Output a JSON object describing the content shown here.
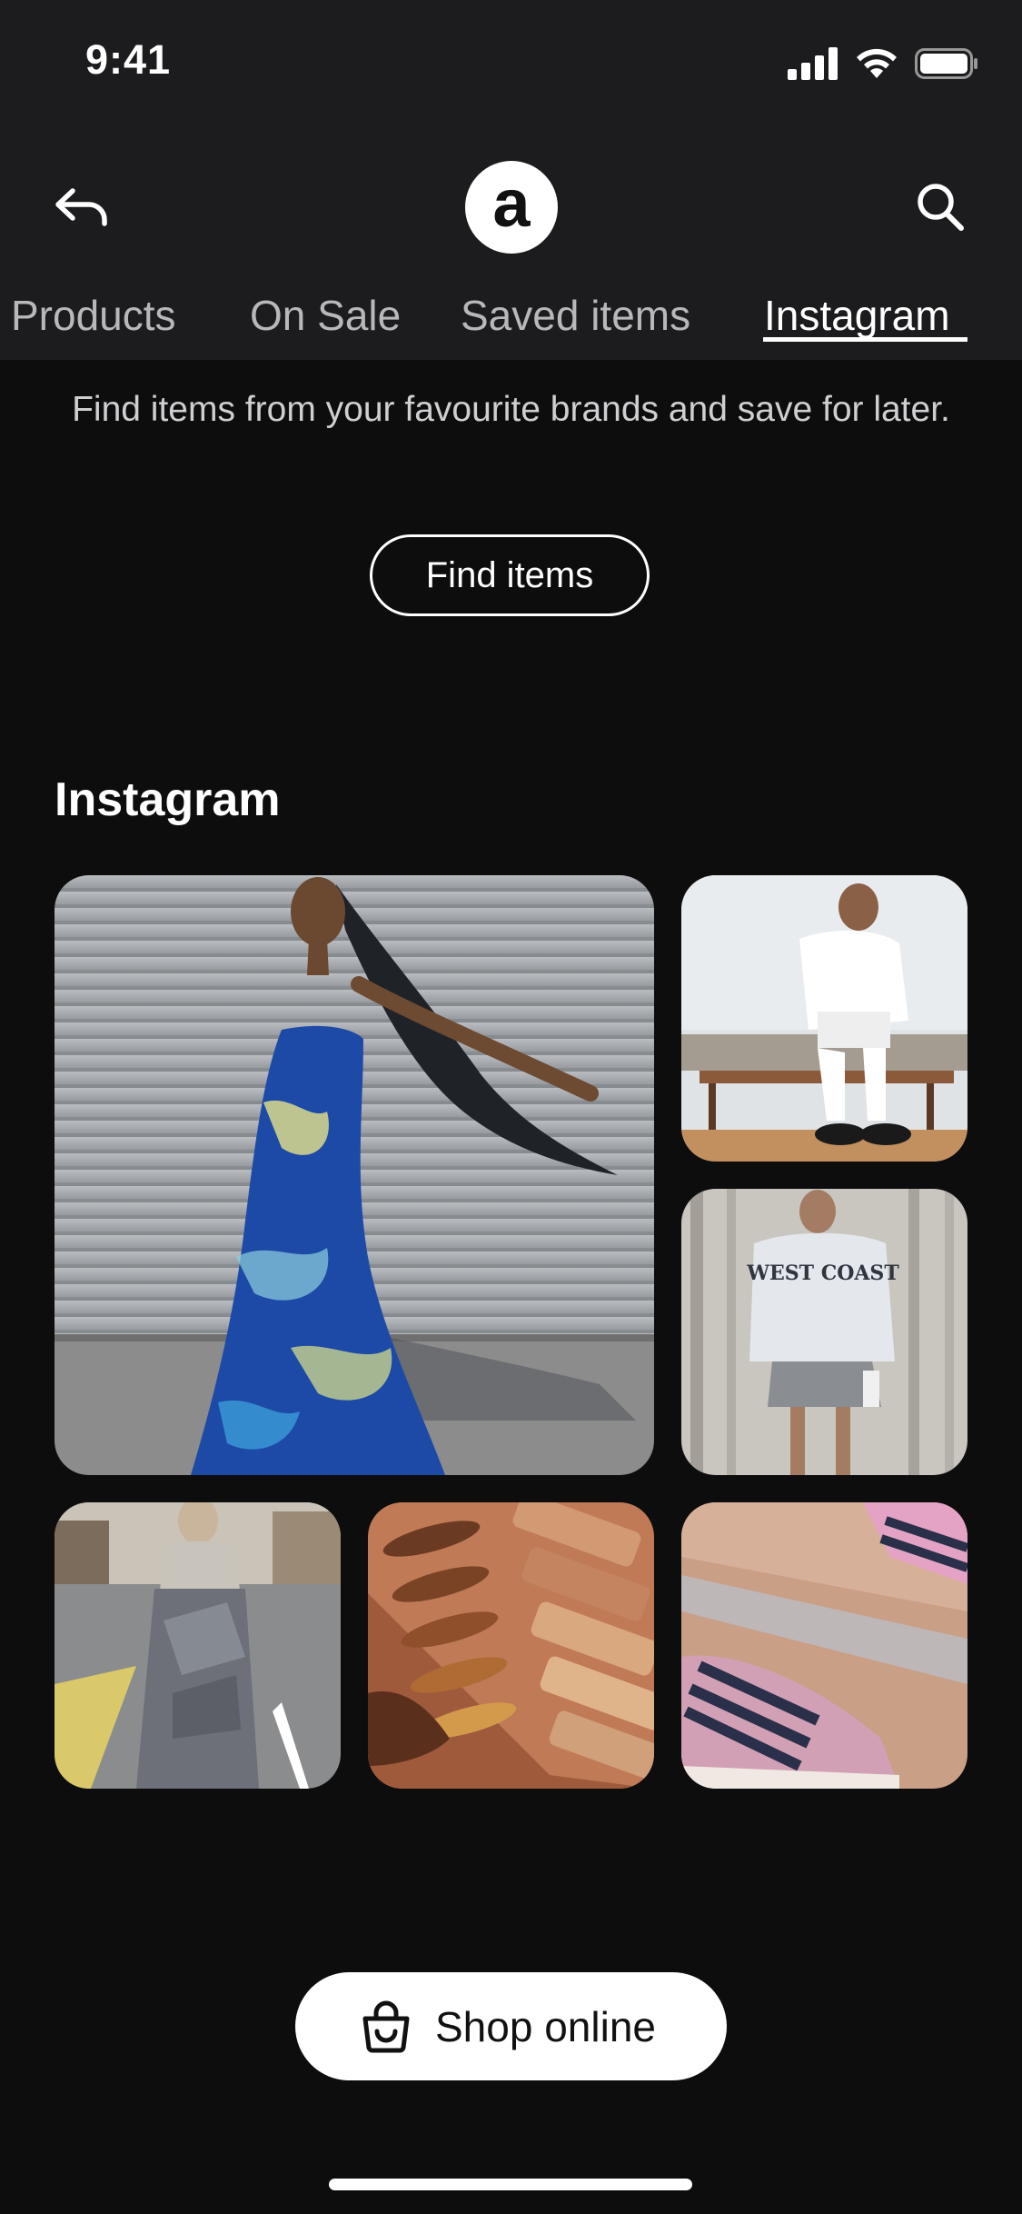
{
  "status_bar": {
    "time": "9:41",
    "icons": [
      "signal-icon",
      "wifi-icon",
      "battery-icon"
    ]
  },
  "nav": {
    "back_icon": "back-arrow-icon",
    "logo_letter": "a",
    "search_icon": "search-icon"
  },
  "tabs": [
    {
      "label": "Products",
      "active": false
    },
    {
      "label": "On Sale",
      "active": false
    },
    {
      "label": "Saved items",
      "active": false
    },
    {
      "label": "Instagram",
      "active": true
    }
  ],
  "promo": {
    "text": "Find items from your favourite brands and save for later.",
    "button_label": "Find items"
  },
  "instagram": {
    "title": "Instagram",
    "posts": [
      {
        "subject": "woman in blue tie-dye strapless gown"
      },
      {
        "subject": "woman in white shirt and loafers sitting on bench"
      },
      {
        "subject": "woman in grey West Coast sweatshirt"
      },
      {
        "subject": "model in grey draped dress on street"
      },
      {
        "subject": "foundation swatches on arm"
      },
      {
        "subject": "pink striped sneakers in box"
      }
    ],
    "post3_text": "WEST COAST"
  },
  "footer": {
    "shop_button_label": "Shop online",
    "shop_icon": "shopping-basket-icon"
  },
  "colors": {
    "background": "#0d0d0e",
    "header": "#1c1c1e",
    "accent": "#ffffff"
  }
}
